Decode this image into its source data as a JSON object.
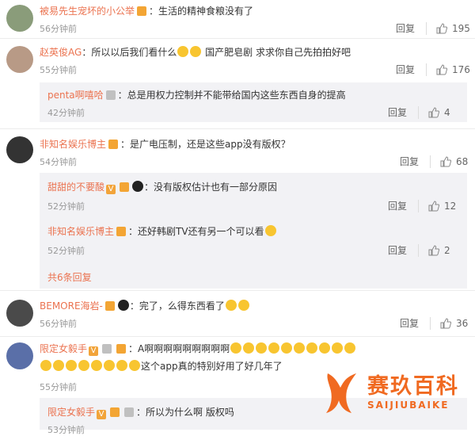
{
  "ui": {
    "reply_label": "回复"
  },
  "comments": [
    {
      "user": "被易先生宠坏的小公举",
      "text": "：生活的精神食粮没有了",
      "time": "56分钟前",
      "likes": "195"
    },
    {
      "user": "赵英俊AG",
      "text": "：所以以后我们看什么",
      "text2": "国产肥皂剧  求求你自己先拍拍好吧",
      "time": "55分钟前",
      "likes": "176",
      "reply": {
        "user": "penta啊嘻哈",
        "text": "：总是用权力控制并不能带给国内这些东西自身的提高",
        "time": "42分钟前",
        "likes": "4"
      }
    },
    {
      "user": "非知名娱乐博主",
      "text": "：是广电压制，还是这些app没有版权？",
      "time": "54分钟前",
      "likes": "68",
      "replies": [
        {
          "user": "甜甜的不要酸",
          "text": "：没有版权估计也有一部分原因",
          "time": "52分钟前",
          "likes": "12"
        },
        {
          "user": "非知名娱乐博主",
          "text": "：还好韩剧TV还有另一个可以看",
          "time": "52分钟前",
          "likes": "2"
        }
      ],
      "more": "共6条回复"
    },
    {
      "user": "BEMORE海岩-",
      "text": "：完了，么得东西看了",
      "time": "56分钟前",
      "likes": "36"
    },
    {
      "user": "限定女毅手",
      "text": "：A啊啊啊啊啊啊啊啊啊",
      "text2": "这个app真的特别好用了好几年了",
      "time": "55分钟前",
      "reply": {
        "user": "限定女毅手",
        "text": "：所以为什么啊 版权吗",
        "time": "53分钟前"
      }
    }
  ],
  "watermark": {
    "cn": "赛玖百科",
    "en": "SAIJIUBAIKE"
  }
}
